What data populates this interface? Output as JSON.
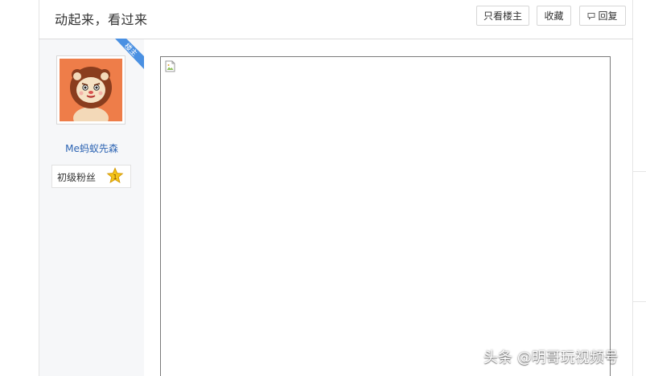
{
  "post": {
    "title": "动起来，看过来"
  },
  "toolbar": {
    "only_op_label": "只看楼主",
    "favorite_label": "收藏",
    "reply_label": "回复"
  },
  "op_badge": {
    "label": "楼主",
    "color": "#4a90e2"
  },
  "author": {
    "name": "Me蚂蚁先森",
    "level_title": "初级粉丝",
    "level_number": "1",
    "avatar_icon": "lion-cartoon-avatar"
  },
  "content": {
    "image_state": "broken-image-icon"
  },
  "watermark": {
    "text": "头条 @明哥玩视频号"
  },
  "colors": {
    "link": "#2d64b3",
    "avatar_bg": "#ee7d49",
    "star": "#f5c518"
  }
}
